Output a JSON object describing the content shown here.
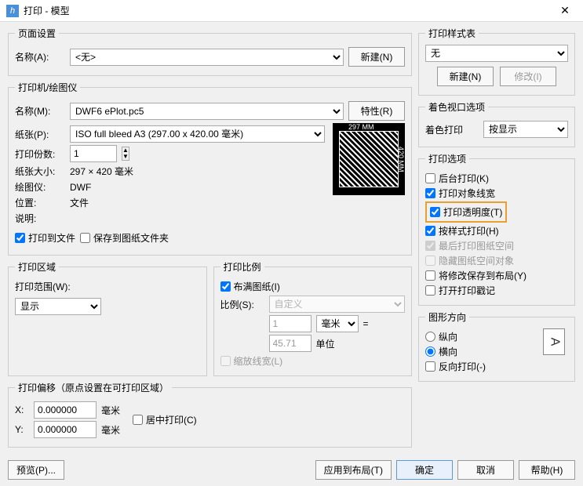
{
  "window": {
    "title": "打印 - 模型"
  },
  "pageSetup": {
    "legend": "页面设置",
    "nameLabel": "名称(A):",
    "nameValue": "<无>",
    "newBtn": "新建(N)"
  },
  "printer": {
    "legend": "打印机/绘图仪",
    "nameLabel": "名称(M):",
    "nameValue": "DWF6 ePlot.pc5",
    "propsBtn": "特性(R)",
    "paperLabel": "纸张(P):",
    "paperValue": "ISO full bleed A3 (297.00 x 420.00 毫米)",
    "copiesLabel": "打印份数:",
    "copiesValue": "1",
    "sizeLabel": "纸张大小:",
    "sizeValue": "297 × 420  毫米",
    "plotterLabel": "绘图仪:",
    "plotterValue": "DWF",
    "locationLabel": "位置:",
    "locationValue": "文件",
    "descLabel": "说明:",
    "toFile": "打印到文件",
    "saveToFolder": "保存到图纸文件夹",
    "previewTop": "297 MM",
    "previewRight": "420 MM"
  },
  "area": {
    "legend": "打印区域",
    "rangeLabel": "打印范围(W):",
    "rangeValue": "显示"
  },
  "scale": {
    "legend": "打印比例",
    "fit": "布满图纸(I)",
    "ratioLabel": "比例(S):",
    "ratioValue": "自定义",
    "num1": "1",
    "unit1": "毫米",
    "eq": "=",
    "num2": "45.71",
    "unit2": "单位",
    "scaleLw": "缩放线宽(L)"
  },
  "offset": {
    "legend": "打印偏移（原点设置在可打印区域）",
    "xLabel": "X:",
    "xValue": "0.000000",
    "xUnit": "毫米",
    "yLabel": "Y:",
    "yValue": "0.000000",
    "yUnit": "毫米",
    "center": "居中打印(C)"
  },
  "styleTable": {
    "legend": "打印样式表",
    "value": "无",
    "newBtn": "新建(N)",
    "modifyBtn": "修改(I)"
  },
  "shaded": {
    "legend": "着色视口选项",
    "label": "着色打印",
    "value": "按显示"
  },
  "options": {
    "legend": "打印选项",
    "bg": "后台打印(K)",
    "lw": "打印对象线宽",
    "trans": "打印透明度(T)",
    "byStyle": "按样式打印(H)",
    "paperLast": "最后打印图纸空间",
    "hidePaper": "隐藏图纸空间对象",
    "saveLayout": "将修改保存到布局(Y)",
    "stamp": "打开打印戳记"
  },
  "orient": {
    "legend": "图形方向",
    "portrait": "纵向",
    "landscape": "横向",
    "reverse": "反向打印(-)",
    "icon": "A"
  },
  "footer": {
    "preview": "预览(P)...",
    "applyLayout": "应用到布局(T)",
    "ok": "确定",
    "cancel": "取消",
    "help": "帮助(H)"
  }
}
